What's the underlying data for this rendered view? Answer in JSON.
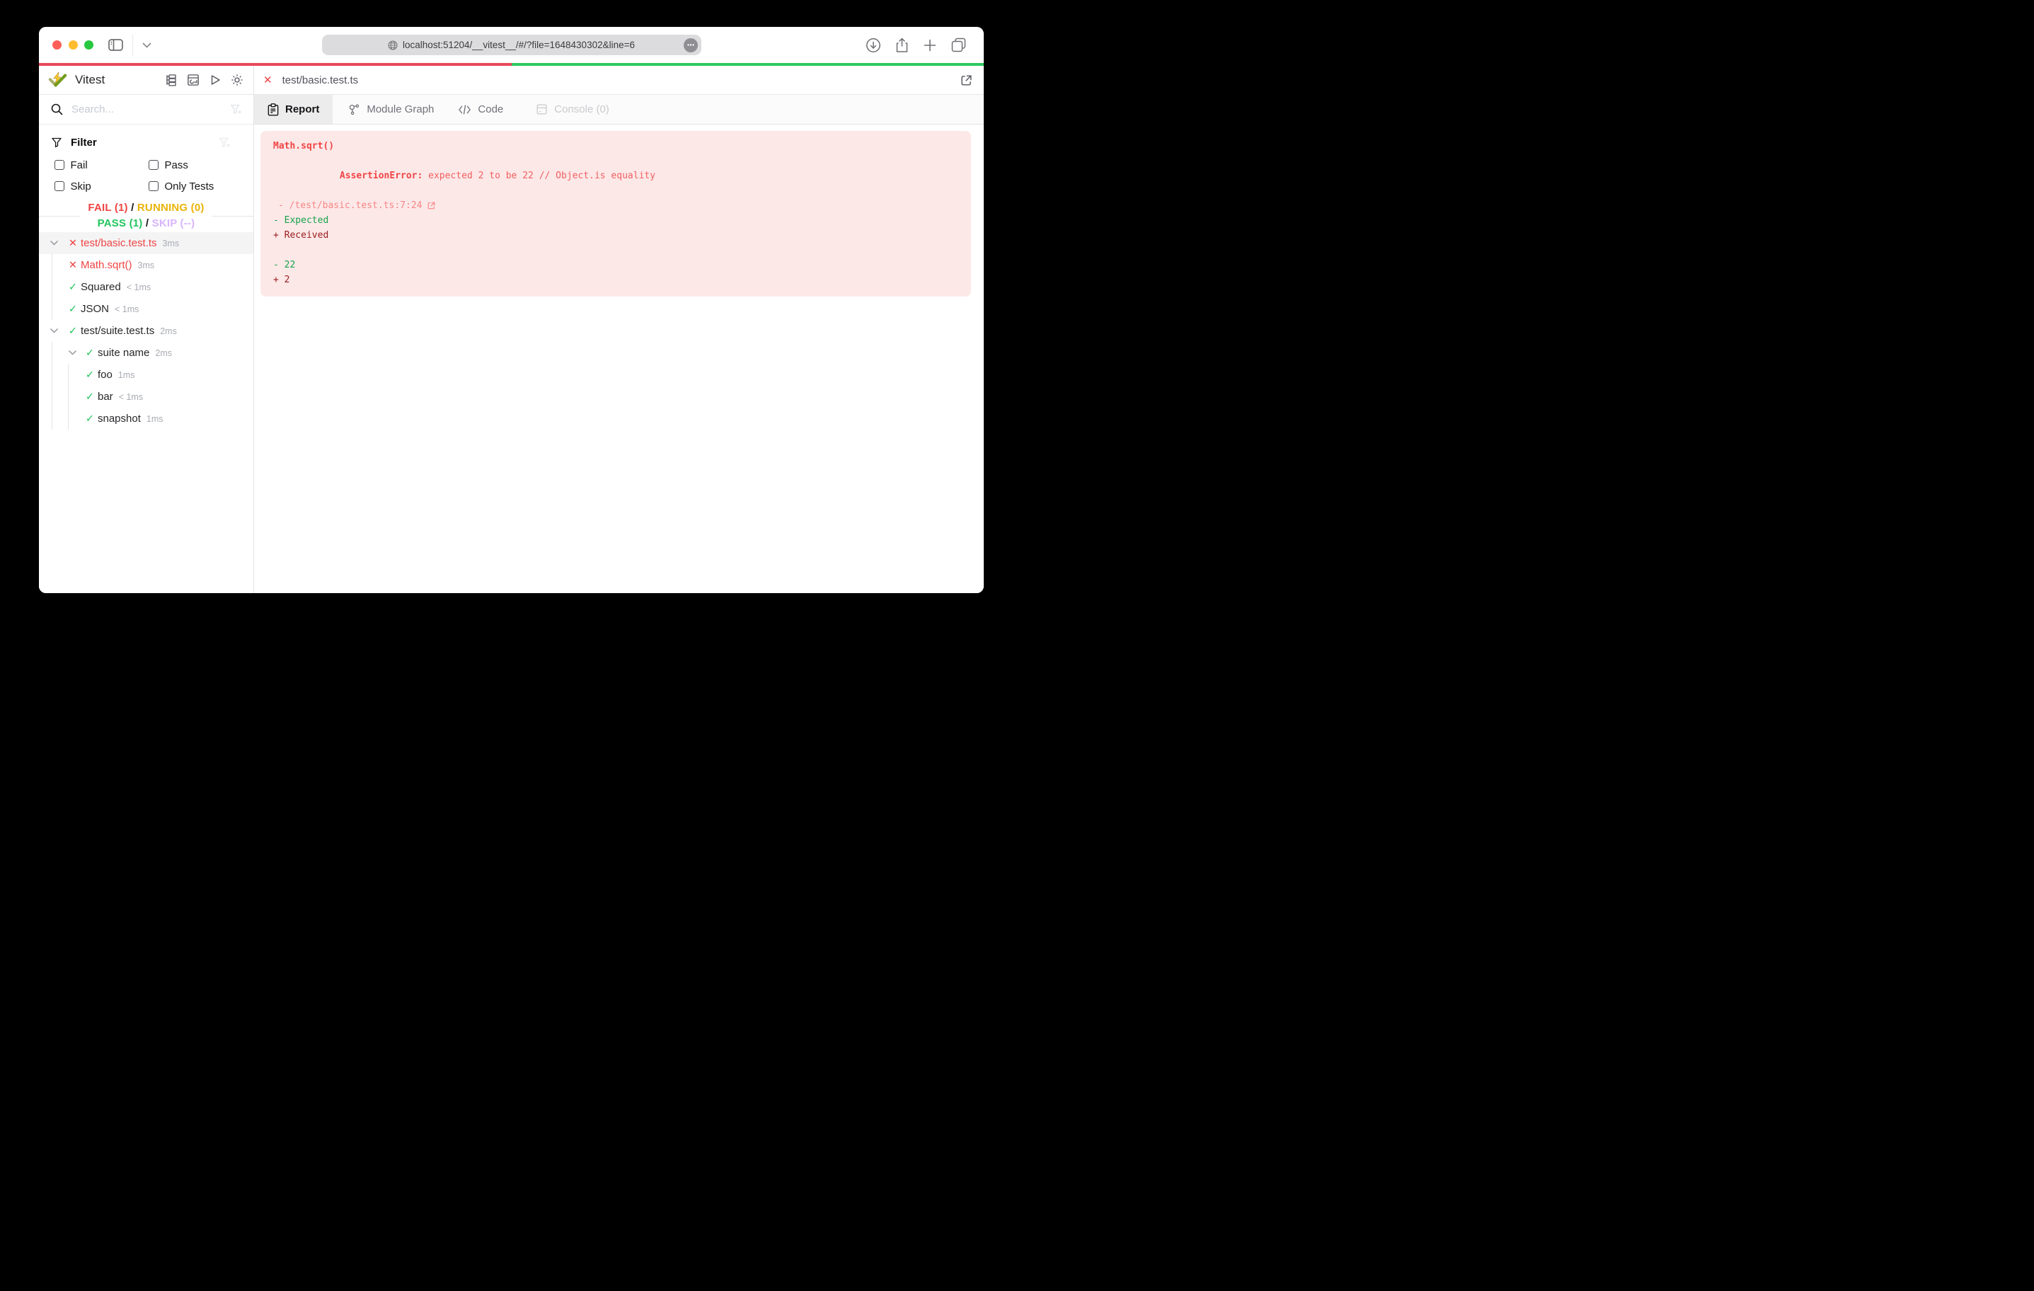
{
  "colors": {
    "fail": "#ef4444",
    "running": "#eab308",
    "pass": "#22c55e",
    "skip": "#d8b4fe",
    "progress_fail": "#e8485a",
    "progress_pass": "#2dc862",
    "error_panel_bg": "#fde8e8",
    "diff_expected": "#16a34a",
    "diff_received": "#991b1b"
  },
  "icons": {
    "close_glyph": "✕",
    "check_glyph": "✓"
  },
  "browser": {
    "url": "localhost:51204/__vitest__/#/?file=1648430302&line=6",
    "progress": {
      "fail_fraction": 0.5,
      "pass_fraction": 0.5
    }
  },
  "sidebar": {
    "app_title": "Vitest",
    "search": {
      "placeholder": "Search..."
    },
    "filter": {
      "title": "Filter",
      "options": [
        "Fail",
        "Pass",
        "Skip",
        "Only Tests"
      ]
    },
    "summary": {
      "fail": "FAIL (1)",
      "sep1": "/",
      "running": "RUNNING (0)",
      "pass": "PASS (1)",
      "sep2": "/",
      "skip": "SKIP (--)"
    },
    "tree": [
      {
        "label": "test/basic.test.ts",
        "duration": "3ms",
        "status": "fail",
        "type": "file",
        "expanded": true,
        "selected": true
      },
      {
        "label": "Math.sqrt()",
        "duration": "3ms",
        "status": "fail",
        "type": "test"
      },
      {
        "label": "Squared",
        "duration": "< 1ms",
        "status": "pass",
        "type": "test"
      },
      {
        "label": "JSON",
        "duration": "< 1ms",
        "status": "pass",
        "type": "test"
      },
      {
        "label": "test/suite.test.ts",
        "duration": "2ms",
        "status": "pass",
        "type": "file",
        "expanded": true
      },
      {
        "label": "suite name",
        "duration": "2ms",
        "status": "pass",
        "type": "suite",
        "expanded": true
      },
      {
        "label": "foo",
        "duration": "1ms",
        "status": "pass",
        "type": "test"
      },
      {
        "label": "bar",
        "duration": "< 1ms",
        "status": "pass",
        "type": "test"
      },
      {
        "label": "snapshot",
        "duration": "1ms",
        "status": "pass",
        "type": "test"
      }
    ]
  },
  "main": {
    "file_header": {
      "file": "test/basic.test.ts"
    },
    "tabs": [
      {
        "label": "Report",
        "state": "active"
      },
      {
        "label": "Module Graph",
        "state": "normal"
      },
      {
        "label": "Code",
        "state": "normal"
      },
      {
        "label": "Console (0)",
        "state": "disabled"
      }
    ],
    "error": {
      "test_name": "Math.sqrt()",
      "error_name": "AssertionError:",
      "message": " expected 2 to be 22 // Object.is equality",
      "stack": "- /test/basic.test.ts:7:24",
      "diff_expected_label": "- Expected",
      "diff_received_label": "+ Received",
      "diff_expected_value": "- 22",
      "diff_received_value": "+ 2"
    }
  }
}
